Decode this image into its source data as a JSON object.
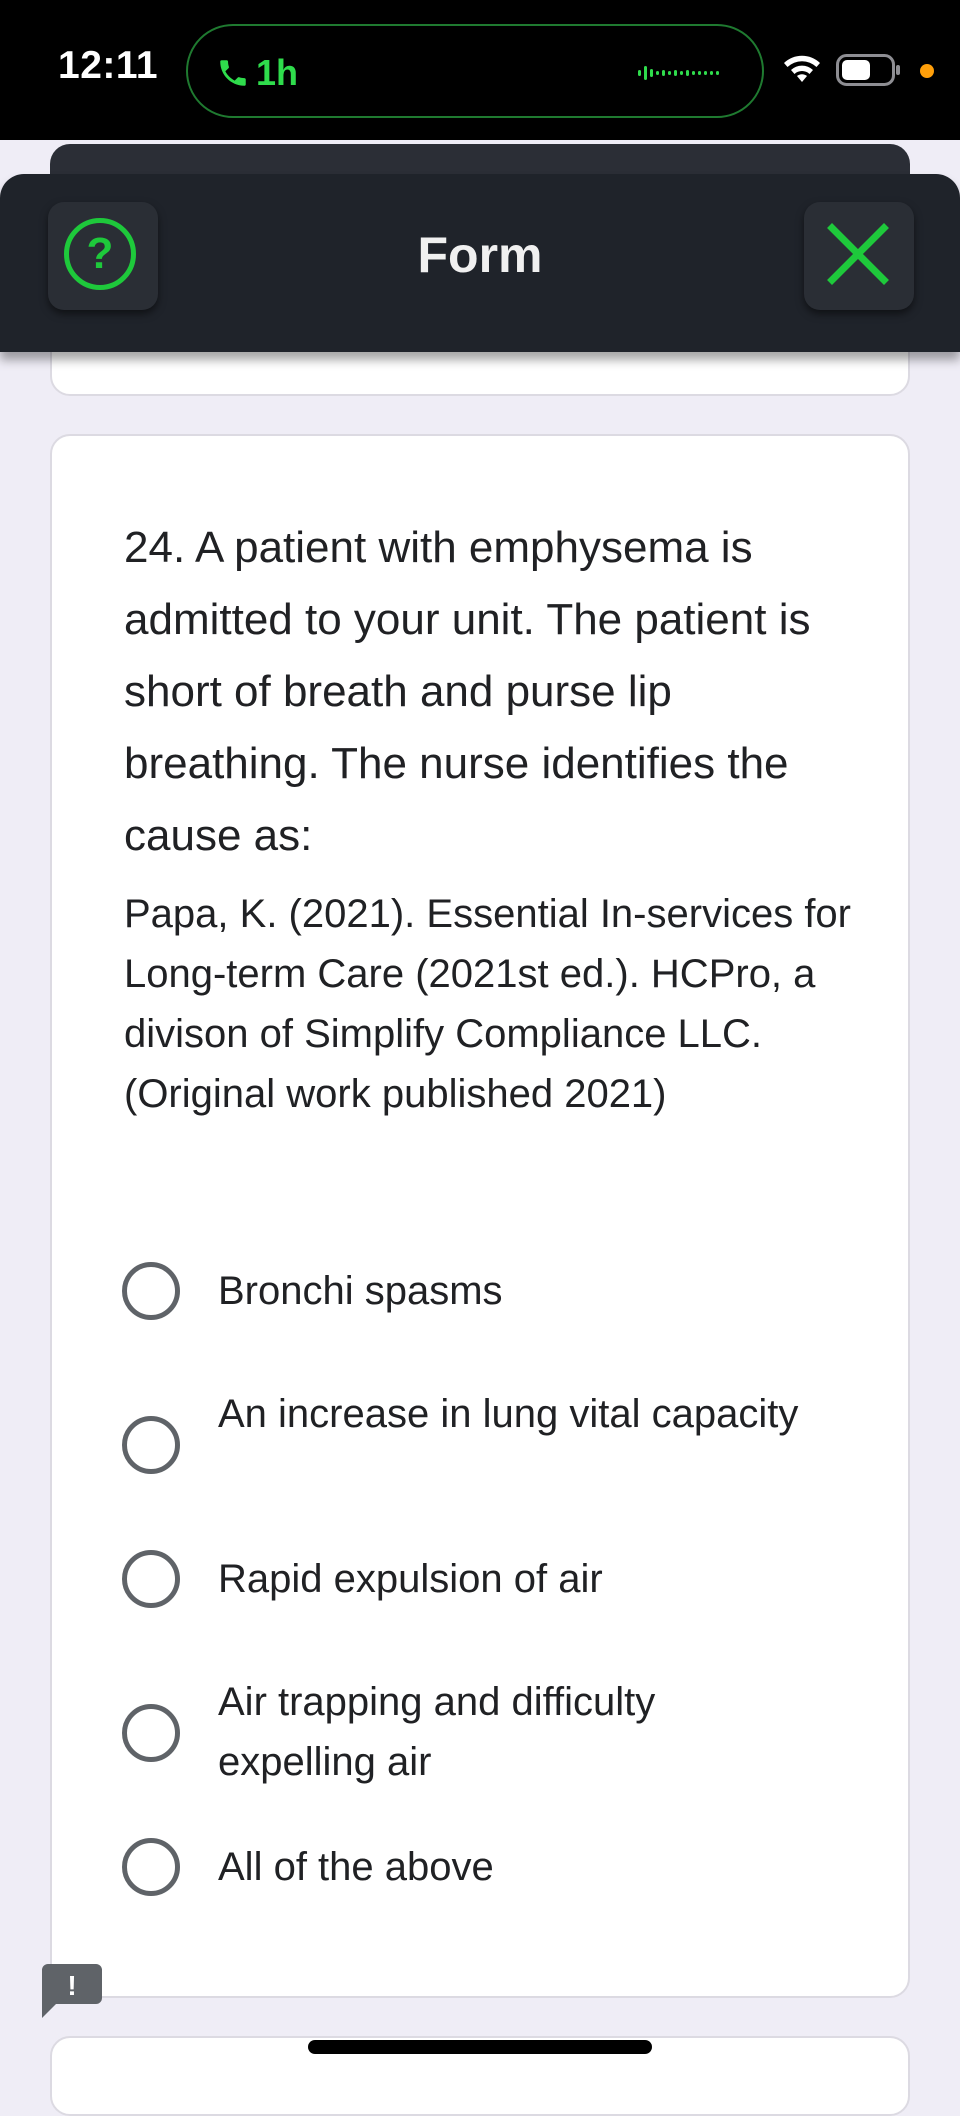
{
  "status_bar": {
    "time": "12:11",
    "call_duration": "1h",
    "icons": [
      "phone-icon",
      "waveform-icon",
      "wifi-icon",
      "battery-icon"
    ]
  },
  "header": {
    "title": "Form",
    "help_icon_label": "?",
    "accent_color": "#1ec93b",
    "background_color": "#1f232a"
  },
  "question": {
    "text": "24.  A patient with emphysema is admitted to your unit. The patient is short of breath and purse lip breathing. The nurse identifies the cause as:",
    "reference": "Papa, K. (2021). Essential In-services for Long-term Care (2021st ed.). HCPro, a divison of Simplify Compliance LLC. (Original work published 2021)",
    "options": [
      {
        "label": "Bronchi spasms"
      },
      {
        "label": "An increase in lung vital capacity"
      },
      {
        "label": "Rapid expulsion of air"
      },
      {
        "label": "Air trapping and difficulty expelling air"
      },
      {
        "label": "All of the above"
      }
    ]
  },
  "feedback": {
    "icon_label": "!"
  }
}
